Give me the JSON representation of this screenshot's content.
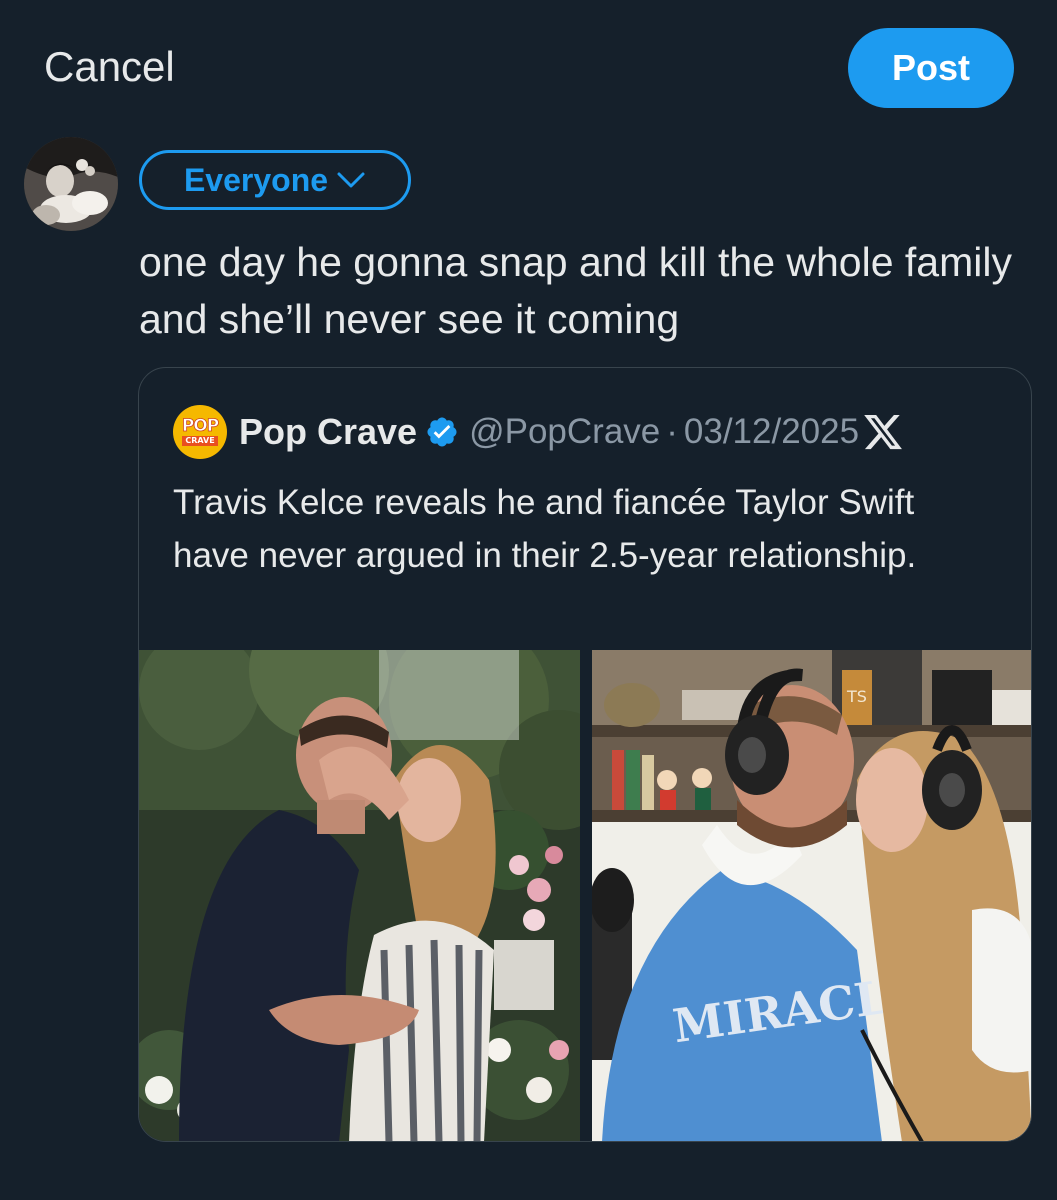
{
  "header": {
    "cancel_label": "Cancel",
    "post_label": "Post"
  },
  "composer": {
    "audience_label": "Everyone",
    "text": "one day he gonna snap and kill the whole family and she’ll never see it coming"
  },
  "quoted_post": {
    "logo_top": "POP",
    "logo_bottom": "CRAVE",
    "author_name": "Pop Crave",
    "handle": "@PopCrave",
    "separator": "·",
    "date": "03/12/2025",
    "text": "Travis Kelce reveals he and fiancée Taylor Swift have never argued in their 2.5-year relationship.",
    "right_image_shirt_text": "MIRACLE",
    "right_image_book_text": "TS"
  },
  "colors": {
    "background": "#15202b",
    "accent": "#1d9bf0",
    "text_primary": "#e7e9ea",
    "text_secondary": "#8b98a5",
    "border": "#38444d"
  },
  "icons": {
    "audience_chevron": "chevron-down-icon",
    "verified": "verified-badge-icon",
    "platform": "x-logo-icon"
  }
}
